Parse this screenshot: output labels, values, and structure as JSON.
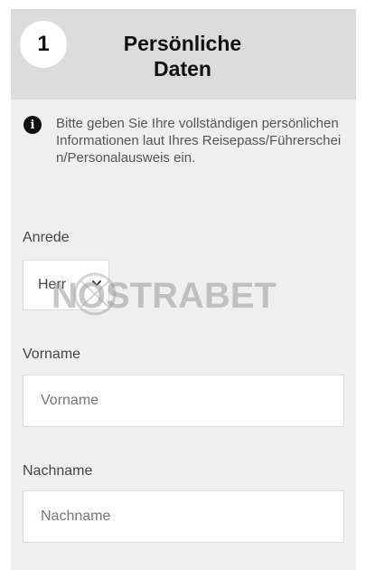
{
  "header": {
    "step_number": "1",
    "title_line1": "Persönliche",
    "title_line2": "Daten"
  },
  "info": {
    "icon": "info-icon",
    "text": "Bitte geben Sie Ihre vollständigen persönlichen Informationen laut Ihres Reisepass/Führerschein/Personalausweis ein."
  },
  "form": {
    "salutation": {
      "label": "Anrede",
      "selected": "Herr"
    },
    "first_name": {
      "label": "Vorname",
      "placeholder": "Vorname"
    },
    "last_name": {
      "label": "Nachname",
      "placeholder": "Nachname"
    }
  },
  "watermark": {
    "text": "NOSTRABET"
  },
  "colors": {
    "header_bg": "#dcdcdc",
    "panel_bg": "#efefef",
    "text_dark": "#111111"
  }
}
